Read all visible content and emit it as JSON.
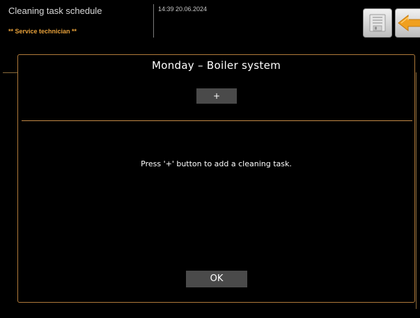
{
  "header": {
    "title": "Cleaning task schedule",
    "role": "** Service technician **",
    "datetime": "14:39 20.06.2024",
    "save_icon": "save-disk-icon",
    "back_icon": "back-arrow-icon"
  },
  "dialog": {
    "title": "Monday – Boiler system",
    "add_label": "+",
    "hint": "Press '+' button to add a cleaning task.",
    "ok_label": "OK"
  },
  "colors": {
    "accent": "#c48a45",
    "role_text": "#e8a13a",
    "button_bg": "#4a4a4a",
    "background": "#000000"
  }
}
